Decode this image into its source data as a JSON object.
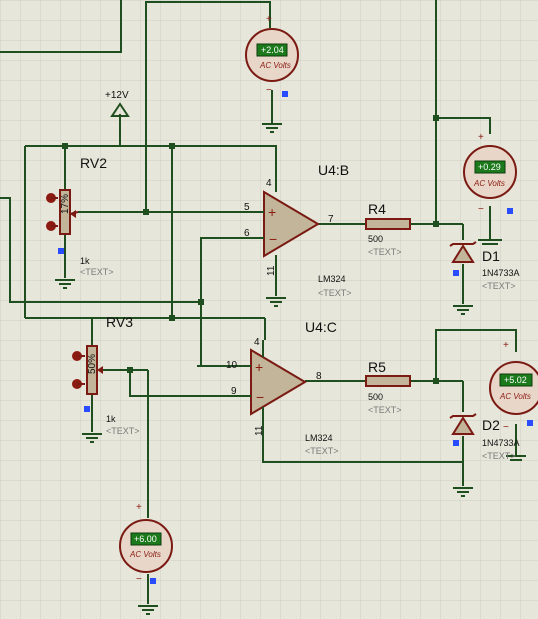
{
  "supply": {
    "label": "+12V"
  },
  "opamps": [
    {
      "ref": "U4:B",
      "part": "LM324",
      "part_text": "<TEXT>",
      "pins": {
        "noninv": "5",
        "inv": "6",
        "out": "7",
        "vplus": "4",
        "vminus": "11"
      }
    },
    {
      "ref": "U4:C",
      "part": "LM324",
      "part_text": "<TEXT>",
      "pins": {
        "noninv": "10",
        "inv": "9",
        "out": "8",
        "vplus": "4",
        "vminus": "11"
      }
    }
  ],
  "pots": [
    {
      "ref": "RV2",
      "value": "1k",
      "value_text": "<TEXT>",
      "percent": "17%"
    },
    {
      "ref": "RV3",
      "value": "1k",
      "value_text": "<TEXT>",
      "percent": "50%"
    }
  ],
  "resistors": [
    {
      "ref": "R4",
      "value": "500",
      "value_text": "<TEXT>"
    },
    {
      "ref": "R5",
      "value": "500",
      "value_text": "<TEXT>"
    }
  ],
  "diodes": [
    {
      "ref": "D1",
      "part": "1N4733A",
      "part_text": "<TEXT>"
    },
    {
      "ref": "D2",
      "part": "1N4733A",
      "part_text": "<TEXT>"
    }
  ],
  "meters": [
    {
      "reading": "+2.04",
      "unit": "AC Volts",
      "plus": "+",
      "minus": "−"
    },
    {
      "reading": "+0.29",
      "unit": "AC Volts",
      "plus": "+",
      "minus": "−"
    },
    {
      "reading": "+5.02",
      "unit": "AC Volts",
      "plus": "+",
      "minus": "−"
    },
    {
      "reading": "+6.00",
      "unit": "AC Volts",
      "plus": "+",
      "minus": "−"
    }
  ],
  "colors": {
    "background": "#e6e6da",
    "grid": "#cfcfc2",
    "wire": "#1f4f1f",
    "component": "#7a1a12",
    "meter_display": "#1c7a1c",
    "pin_marker": "#2a4cff"
  }
}
